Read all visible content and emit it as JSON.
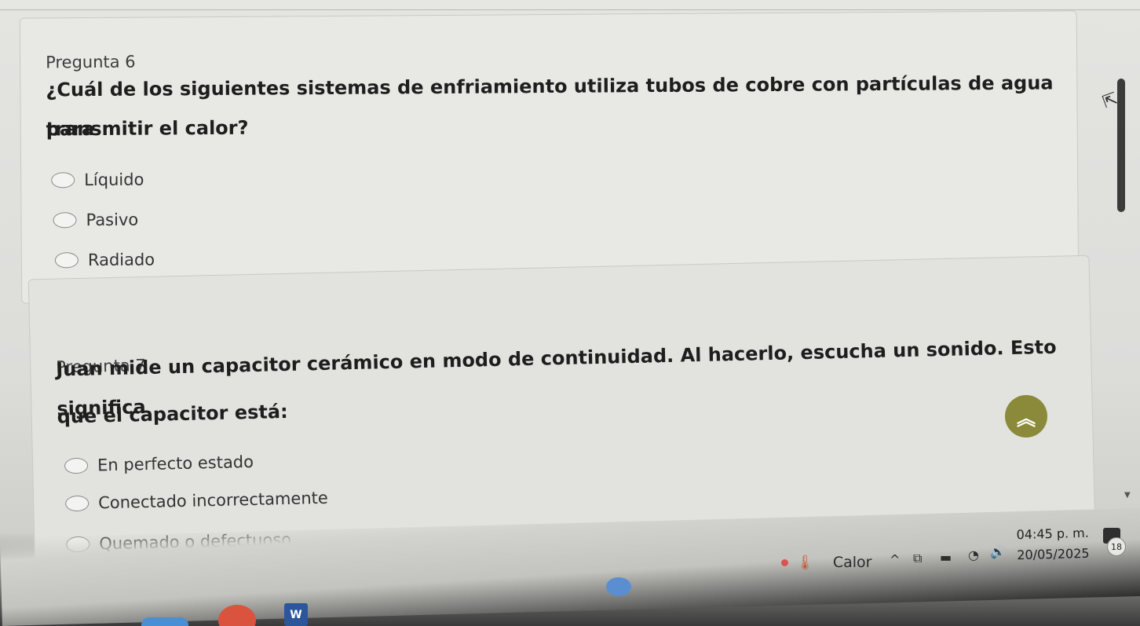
{
  "questions": [
    {
      "number": "Pregunta 6",
      "text_line1": "¿Cuál de los siguientes sistemas de enfriamiento utiliza tubos de cobre con partículas de agua para",
      "text_line2": "transmitir el calor?",
      "options": [
        "Líquido",
        "Pasivo",
        "Radiado"
      ]
    },
    {
      "number": "Pregunta 7",
      "text_line1": "Juan mide un capacitor cerámico en modo de continuidad. Al hacerlo, escucha un sonido. Esto significa",
      "text_line2": "que el capacitor está:",
      "options": [
        "En perfecto estado",
        "Conectado incorrectamente",
        "Quemado o defectuoso"
      ]
    }
  ],
  "taskbar": {
    "weather_label": "Calor",
    "time": "04:45 p. m.",
    "date": "20/05/2025",
    "notification_count": "18"
  },
  "icons": {
    "back_to_top": "double-chevron-up-icon",
    "word": "word-app-icon"
  }
}
